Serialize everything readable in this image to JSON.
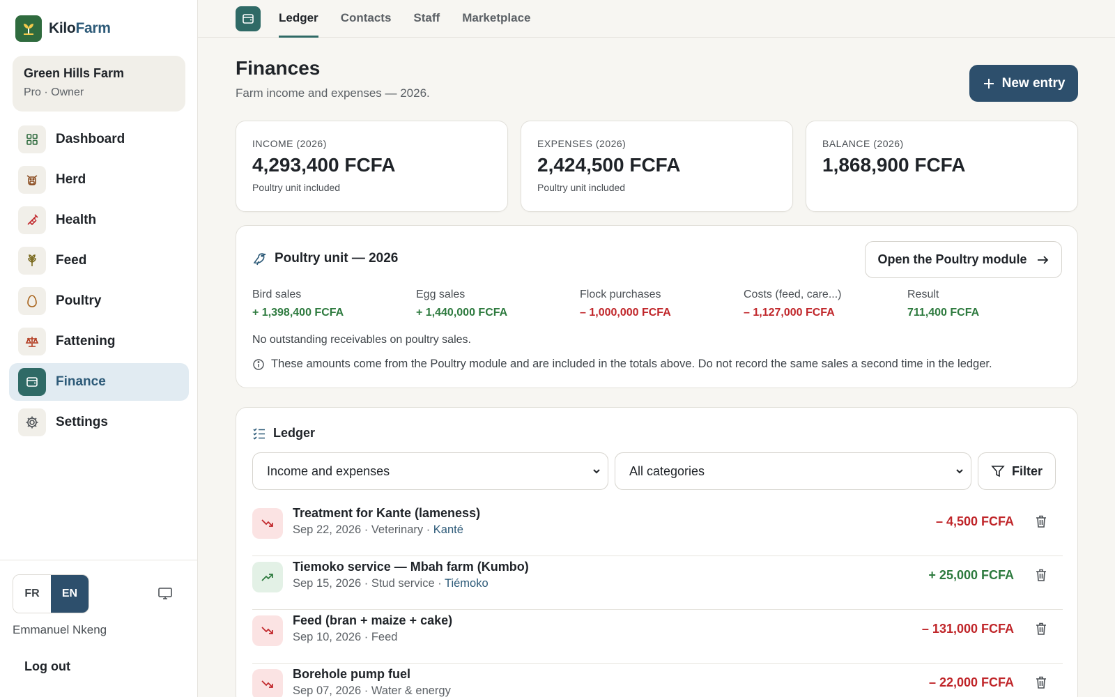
{
  "brand": {
    "name_part1": "Kilo",
    "name_part2": "Farm"
  },
  "farm": {
    "name": "Green Hills Farm",
    "plan": "Pro · Owner"
  },
  "nav": [
    {
      "label": "Dashboard",
      "icon": "grid-icon"
    },
    {
      "label": "Herd",
      "icon": "cow-icon"
    },
    {
      "label": "Health",
      "icon": "syringe-icon"
    },
    {
      "label": "Feed",
      "icon": "wheat-icon"
    },
    {
      "label": "Poultry",
      "icon": "egg-icon"
    },
    {
      "label": "Fattening",
      "icon": "scale-icon"
    },
    {
      "label": "Finance",
      "icon": "wallet-icon",
      "active": true
    },
    {
      "label": "Settings",
      "icon": "gear-icon"
    }
  ],
  "lang": {
    "fr": "FR",
    "en": "EN",
    "active": "EN"
  },
  "user": {
    "name": "Emmanuel Nkeng",
    "logout": "Log out"
  },
  "tabs": [
    "Ledger",
    "Contacts",
    "Staff",
    "Marketplace"
  ],
  "page": {
    "title": "Finances",
    "subtitle": "Farm income and expenses — 2026.",
    "new_entry": "New entry"
  },
  "stats": [
    {
      "label": "INCOME (2026)",
      "value": "4,293,400 FCFA",
      "note": "Poultry unit included"
    },
    {
      "label": "EXPENSES (2026)",
      "value": "2,424,500 FCFA",
      "note": "Poultry unit included"
    },
    {
      "label": "BALANCE (2026)",
      "value": "1,868,900 FCFA",
      "note": ""
    }
  ],
  "poultry": {
    "title": "Poultry unit — 2026",
    "open_button": "Open the Poultry module",
    "metrics": [
      {
        "label": "Bird sales",
        "value": "+ 1,398,400 FCFA",
        "tone": "pos"
      },
      {
        "label": "Egg sales",
        "value": "+ 1,440,000 FCFA",
        "tone": "pos"
      },
      {
        "label": "Flock purchases",
        "value": "– 1,000,000 FCFA",
        "tone": "neg"
      },
      {
        "label": "Costs (feed, care...)",
        "value": "– 1,127,000 FCFA",
        "tone": "neg"
      },
      {
        "label": "Result",
        "value": "711,400 FCFA",
        "tone": "pos"
      }
    ],
    "note": "No outstanding receivables on poultry sales.",
    "info": "These amounts come from the Poultry module and are included in the totals above. Do not record the same sales a second time in the ledger."
  },
  "ledger": {
    "title": "Ledger",
    "type_select": "Income and expenses",
    "category_select": "All categories",
    "filter": "Filter",
    "rows": [
      {
        "title": "Treatment for Kante (lameness)",
        "meta": "Sep 22, 2026 · Veterinary · ",
        "link": "Kanté",
        "amount": "– 4,500 FCFA",
        "direction": "out"
      },
      {
        "title": "Tiemoko service — Mbah farm (Kumbo)",
        "meta": "Sep 15, 2026 · Stud service · ",
        "link": "Tiémoko",
        "amount": "+ 25,000 FCFA",
        "direction": "in"
      },
      {
        "title": "Feed (bran + maize + cake)",
        "meta": "Sep 10, 2026 · Feed",
        "link": "",
        "amount": "– 131,000 FCFA",
        "direction": "out"
      },
      {
        "title": "Borehole pump fuel",
        "meta": "Sep 07, 2026 · Water & energy",
        "link": "",
        "amount": "– 22,000 FCFA",
        "direction": "out"
      }
    ]
  },
  "colors": {
    "accent": "#2d4f6c",
    "teal": "#2f6a66",
    "positive": "#2d7a3e",
    "negative": "#c0262a"
  }
}
